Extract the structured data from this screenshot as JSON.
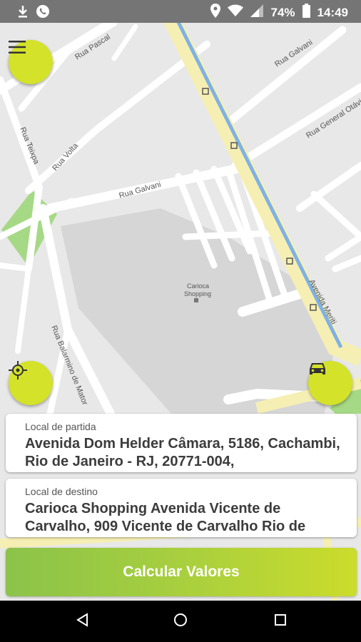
{
  "status_bar": {
    "battery_percent": "74%",
    "time": "14:49"
  },
  "map": {
    "streets": [
      "Rua Pascal",
      "Rua Galvani",
      "Rua Galvani",
      "Rua General Otávio Pe",
      "Rua Teixpa",
      "Rua Volta",
      "Rua Balarmino de Mator",
      "Avenida Meriti"
    ],
    "poi": {
      "name_line1": "Carioca",
      "name_line2": "Shopping"
    }
  },
  "origin": {
    "label": "Local de partida",
    "value": "Avenida Dom Helder Câmara, 5186, Cachambi, Rio de Janeiro - RJ, 20771-004,"
  },
  "destination": {
    "label": "Local de destino",
    "value": "Carioca Shopping Avenida Vicente de Carvalho, 909 Vicente de Carvalho Rio de"
  },
  "actions": {
    "calculate_label": "Calcular Valores"
  },
  "colors": {
    "accent": "#d4e22a",
    "button_start": "#8bc34a",
    "button_end": "#cbdc2c"
  },
  "icons": [
    "download-icon",
    "whatsapp-icon",
    "location-icon",
    "wifi-icon",
    "signal-icon",
    "battery-icon",
    "menu-icon",
    "gps-target-icon",
    "car-icon",
    "back-icon",
    "home-icon",
    "recents-icon"
  ]
}
